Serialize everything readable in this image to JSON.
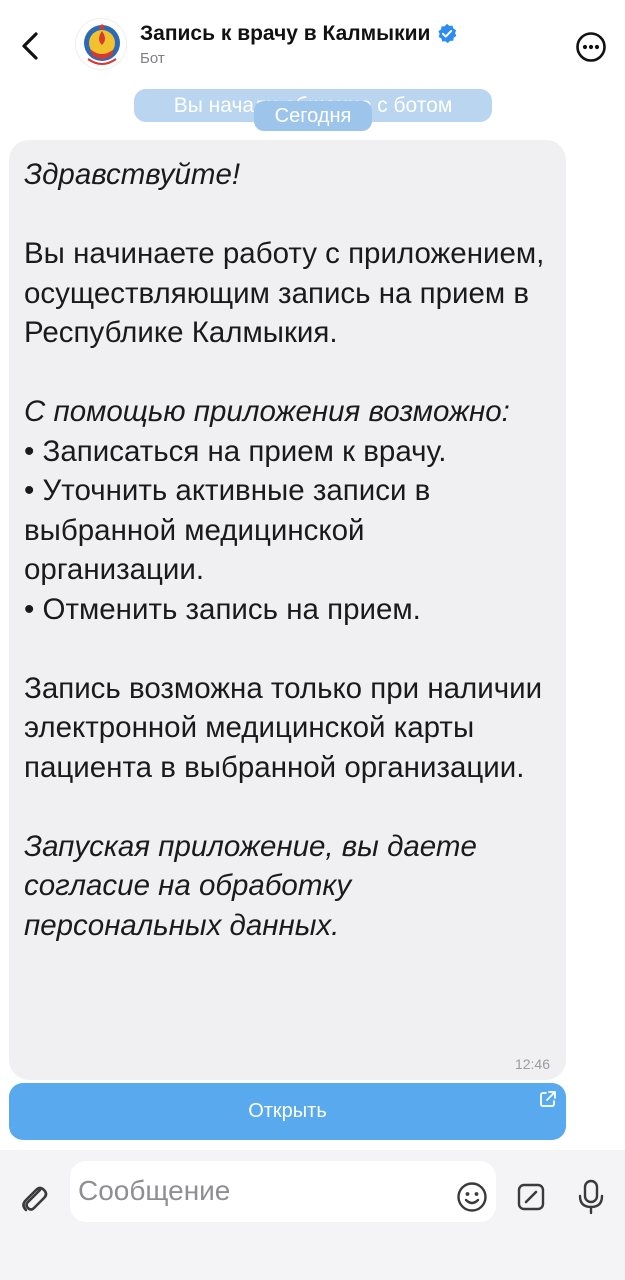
{
  "header": {
    "title": "Запись к врачу в Калмыкии",
    "subtitle": "Бот",
    "verified": true
  },
  "system": {
    "start_notice": "Вы начали общение с ботом",
    "date_label": "Сегодня"
  },
  "message": {
    "greeting": "Здравствуйте!",
    "intro": "Вы начинаете работу с приложением, осуществляющим запись на прием в Республике Калмыкия.",
    "features_title": "С помощью приложения возможно:",
    "features": [
      "• Записаться на прием к врачу.",
      "• Уточнить активные записи в выбранной медицинской организации.",
      "• Отменить запись на прием."
    ],
    "requirement": "Запись возможна только при наличии электронной медицинской карты пациента в выбранной организации.",
    "consent": "Запуская приложение, вы даете согласие на обработку персональных данных.",
    "time": "12:46"
  },
  "inline_button": {
    "label": "Открыть",
    "icon": "external-link-icon"
  },
  "composer": {
    "placeholder": "Сообщение",
    "icons": [
      "paperclip-icon",
      "emoji-icon",
      "sticker-icon",
      "microphone-icon"
    ]
  },
  "colors": {
    "accent": "#58a9ee",
    "bubble": "#f0f0f2",
    "verified": "#2d8cf0"
  }
}
